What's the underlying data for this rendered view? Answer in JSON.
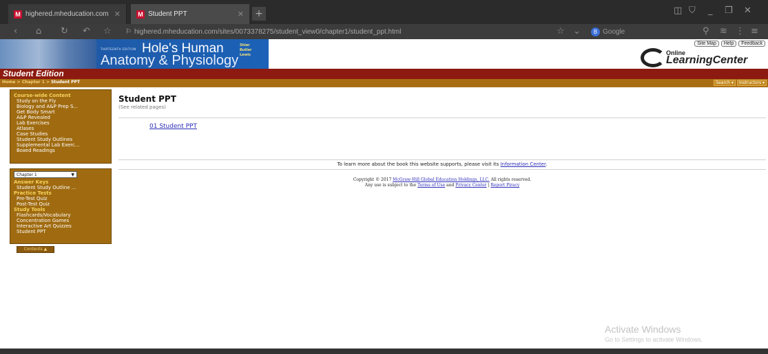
{
  "browser": {
    "tabs": [
      {
        "label": "highered.mheducation.com",
        "favicon": "M"
      },
      {
        "label": "Student PPT",
        "favicon": "M"
      }
    ],
    "url": "highered.mheducation.com/sites/0073378275/student_view0/chapter1/student_ppt.html",
    "search_engine": "Google",
    "search_badge": "B"
  },
  "header": {
    "edition_label": "THIRTEENTH EDITION",
    "title_line1": "Hole's Human",
    "title_line2": "Anatomy & Physiology",
    "authors": [
      "Shier",
      "Butler",
      "Lewis"
    ],
    "links": [
      "Site Map",
      "Help",
      "Feedback"
    ],
    "olc_online": "Online",
    "olc_learning_center": "LearningCenter",
    "edition_bar": "Student Edition"
  },
  "breadcrumb": {
    "home": "Home",
    "sep": " > ",
    "chapter": "Chapter 1",
    "current": "Student PPT",
    "buttons": [
      "Search ▾",
      "Instructors ▾"
    ]
  },
  "sidebar": {
    "course_heading": "Course-wide Content",
    "course_items": [
      "Study on the Fly",
      "Biology and A&P Prep S...",
      "Get Body Smart",
      "A&P Revealed",
      "Lab Exercises",
      "Atlases",
      "Case Studies",
      "Student Study Outlines",
      "Supplemental Lab Exerc...",
      "Boxed Readings"
    ],
    "chapter_select": "Chapter 1",
    "answer_heading": "Answer Keys",
    "answer_items": [
      "Student Study Outline ..."
    ],
    "practice_heading": "Practice Tests",
    "practice_items": [
      "Pre-Test Quiz",
      "Post-Test Quiz"
    ],
    "study_heading": "Study Tools",
    "study_items": [
      "Flashcards/Vocabulary",
      "Concentration Games",
      "Interactive Art Quizzes",
      "Student PPT"
    ],
    "contents_button": "Contents ▲"
  },
  "main": {
    "title": "Student PPT",
    "related": "(See related pages)",
    "ppt_link": "01 Student PPT",
    "info_text": "To learn more about the book this website supports, please visit its ",
    "info_link": "Information Center",
    "info_end": ".",
    "copyright_prefix": "Copyright © 2017 ",
    "copyright_link": "McGraw-Hill Global Education Holdings, LLC.",
    "copyright_suffix": " All rights reserved.",
    "use_prefix": "Any use is subject to the ",
    "terms_link": "Terms of Use",
    "and_text": " and ",
    "privacy_link": "Privacy Center",
    "pipe": " | ",
    "piracy_link": "Report Piracy"
  },
  "os": {
    "watermark_title": "Activate Windows",
    "watermark_sub": "Go to Settings to activate Windows."
  },
  "colors": {
    "edition_bar": "#8c1a10",
    "crumb_bar": "#a96e14",
    "sidebar": "#a06b10",
    "link": "#2b2bb8"
  }
}
